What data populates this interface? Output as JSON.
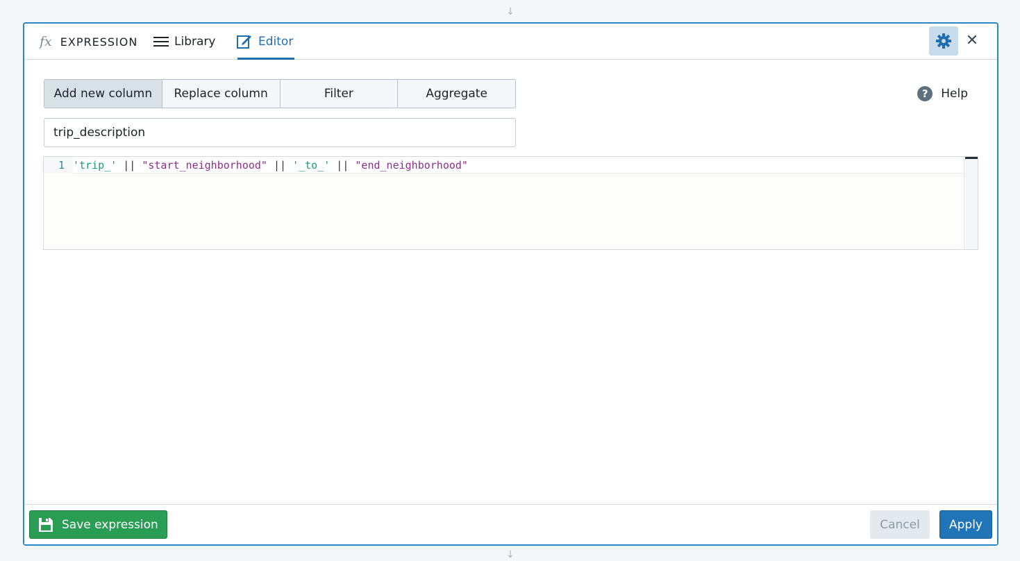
{
  "header": {
    "fx_symbol": "fx",
    "title": "EXPRESSION",
    "tabs": [
      {
        "label": "Library",
        "icon": "list-icon"
      },
      {
        "label": "Editor",
        "icon": "edit-icon",
        "active": true
      }
    ],
    "settings_icon": "gear-icon",
    "close_icon": "close-icon",
    "close_glyph": "✕"
  },
  "mode_selector": {
    "options": [
      "Add new column",
      "Replace column",
      "Filter",
      "Aggregate"
    ],
    "selected": "Add new column"
  },
  "help": {
    "label": "Help",
    "glyph": "?"
  },
  "column_name": {
    "value": "trip_description"
  },
  "code_editor": {
    "line_number": "1",
    "tokens": [
      "'trip_'",
      " || ",
      "\"start_neighborhood\"",
      " || ",
      "'_to_'",
      " || ",
      "\"end_neighborhood\""
    ]
  },
  "footer": {
    "save_label": "Save expression",
    "cancel_label": "Cancel",
    "apply_label": "Apply"
  },
  "colors": {
    "accent": "#1f75b8",
    "save": "#2a9d55",
    "string_token": "#1b9c7a",
    "column_token": "#8e2f8c"
  }
}
